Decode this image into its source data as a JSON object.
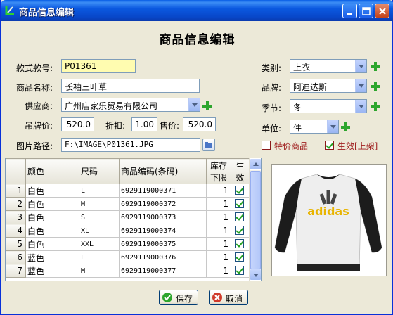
{
  "window": {
    "title": "商品信息编辑"
  },
  "form": {
    "heading": "商品信息编辑",
    "style_no": {
      "label": "款式款号:",
      "value": "P01361"
    },
    "product_name": {
      "label": "商品名称:",
      "value": "长袖三叶草"
    },
    "supplier": {
      "label": "供应商:",
      "value": "广州店家乐贸易有限公司"
    },
    "tag_price": {
      "label": "吊牌价:",
      "value": "520.0"
    },
    "discount": {
      "label": "折扣:",
      "value": "1.00"
    },
    "sale_price": {
      "label": "售价:",
      "value": "520.0"
    },
    "image_path": {
      "label": "图片路径:",
      "value": "F:\\IMAGE\\P01361.JPG"
    },
    "category": {
      "label": "类别:",
      "value": "上衣"
    },
    "brand": {
      "label": "品牌:",
      "value": "阿迪达斯"
    },
    "season": {
      "label": "季节:",
      "value": "冬"
    },
    "unit": {
      "label": "单位:",
      "value": "件"
    },
    "special_price": {
      "label": "特价商品",
      "checked": false
    },
    "active": {
      "label": "生效[上架]",
      "checked": true
    }
  },
  "grid": {
    "headers": [
      "颜色",
      "尺码",
      "商品编码(条码)",
      "库存下限",
      "生效"
    ],
    "rows": [
      {
        "n": "1",
        "color": "白色",
        "size": "L",
        "code": "6929119000371",
        "min": "1",
        "active": true
      },
      {
        "n": "2",
        "color": "白色",
        "size": "M",
        "code": "6929119000372",
        "min": "1",
        "active": true
      },
      {
        "n": "3",
        "color": "白色",
        "size": "S",
        "code": "6929119000373",
        "min": "1",
        "active": true
      },
      {
        "n": "4",
        "color": "白色",
        "size": "XL",
        "code": "6929119000374",
        "min": "1",
        "active": true
      },
      {
        "n": "5",
        "color": "白色",
        "size": "XXL",
        "code": "6929119000375",
        "min": "1",
        "active": true
      },
      {
        "n": "6",
        "color": "蓝色",
        "size": "L",
        "code": "6929119000376",
        "min": "1",
        "active": true
      },
      {
        "n": "7",
        "color": "蓝色",
        "size": "M",
        "code": "6929119000377",
        "min": "1",
        "active": true
      }
    ]
  },
  "product_image": {
    "logo_text": "adidas"
  },
  "buttons": {
    "save": "保存",
    "cancel": "取消"
  },
  "colors": {
    "title_bar": "#0a5fe6",
    "accent_green": "#2da52d",
    "cancel_red": "#d03a2a",
    "highlight": "#fffcb0"
  }
}
